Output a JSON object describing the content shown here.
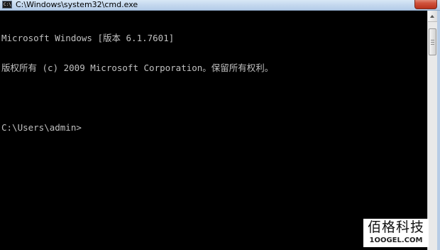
{
  "window": {
    "title": "C:\\Windows\\system32\\cmd.exe",
    "icon_text": "C:\\",
    "icon": "cmd-console-icon"
  },
  "console": {
    "lines": [
      "Microsoft Windows [版本 6.1.7601]",
      "版权所有 (c) 2009 Microsoft Corporation。保留所有权利。",
      "",
      "C:\\Users\\admin>"
    ],
    "text_color": "#c0c0c0",
    "background_color": "#000000"
  },
  "watermark": {
    "text_cn": "佰格科技",
    "url": "1OOGEL.COM"
  }
}
